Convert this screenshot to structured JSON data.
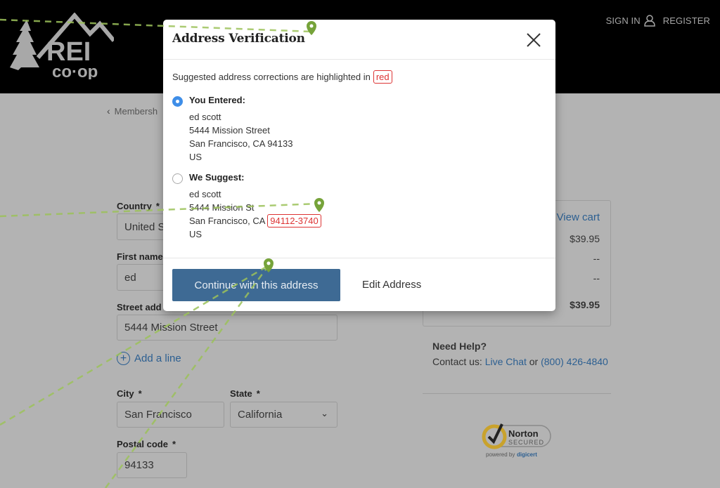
{
  "header": {
    "logo_alt": "REI co-op",
    "logo_text_main": "REI",
    "logo_text_sub": "co·op",
    "sign_in": "SIGN IN",
    "register": "REGISTER"
  },
  "page": {
    "back_link": "Membersh",
    "form": {
      "country": {
        "label": "Country",
        "required": "*",
        "value": "United S"
      },
      "first_name": {
        "label": "First name",
        "value": "ed"
      },
      "street": {
        "label": "Street add",
        "value": "5444 Mission Street"
      },
      "add_line": "Add a line",
      "city": {
        "label": "City",
        "required": "*",
        "value": "San Francisco"
      },
      "state": {
        "label": "State",
        "required": "*",
        "value": "California"
      },
      "postal": {
        "label": "Postal code",
        "required": "*",
        "value": "94133"
      }
    },
    "summary": {
      "view_cart": "View cart",
      "subtotal": "$39.95",
      "shipping": "--",
      "tax": "--",
      "total": "$39.95"
    },
    "help": {
      "title": "Need Help?",
      "contact_prefix": "Contact us:",
      "live_chat": "Live Chat",
      "or": "or",
      "phone": "(800) 426-4840"
    },
    "norton": {
      "brand": "Norton",
      "secured": "SECURED",
      "powered": "powered by",
      "digicert": "digicert"
    }
  },
  "modal": {
    "title": "Address Verification",
    "hint_text": "Suggested address corrections are highlighted in",
    "hint_tag": "red",
    "entered": {
      "title": "You Entered:",
      "selected": true,
      "name": "ed scott",
      "street": "5444 Mission Street",
      "city_state": "San Francisco, CA 94133",
      "country": "US"
    },
    "suggested": {
      "title": "We Suggest:",
      "selected": false,
      "name": "ed scott",
      "street": "5444 Mission St",
      "city_state": "San Francisco, CA",
      "zip_corrected": "94112-3740",
      "country": "US"
    },
    "continue_label": "Continue with this address",
    "edit_label": "Edit Address"
  },
  "colors": {
    "accent_blue": "#3e6a94",
    "link_blue": "#2c5f91",
    "radio_blue": "#3f8ee8",
    "correction_red": "#dd3333",
    "annotation_green": "#76a33a"
  }
}
